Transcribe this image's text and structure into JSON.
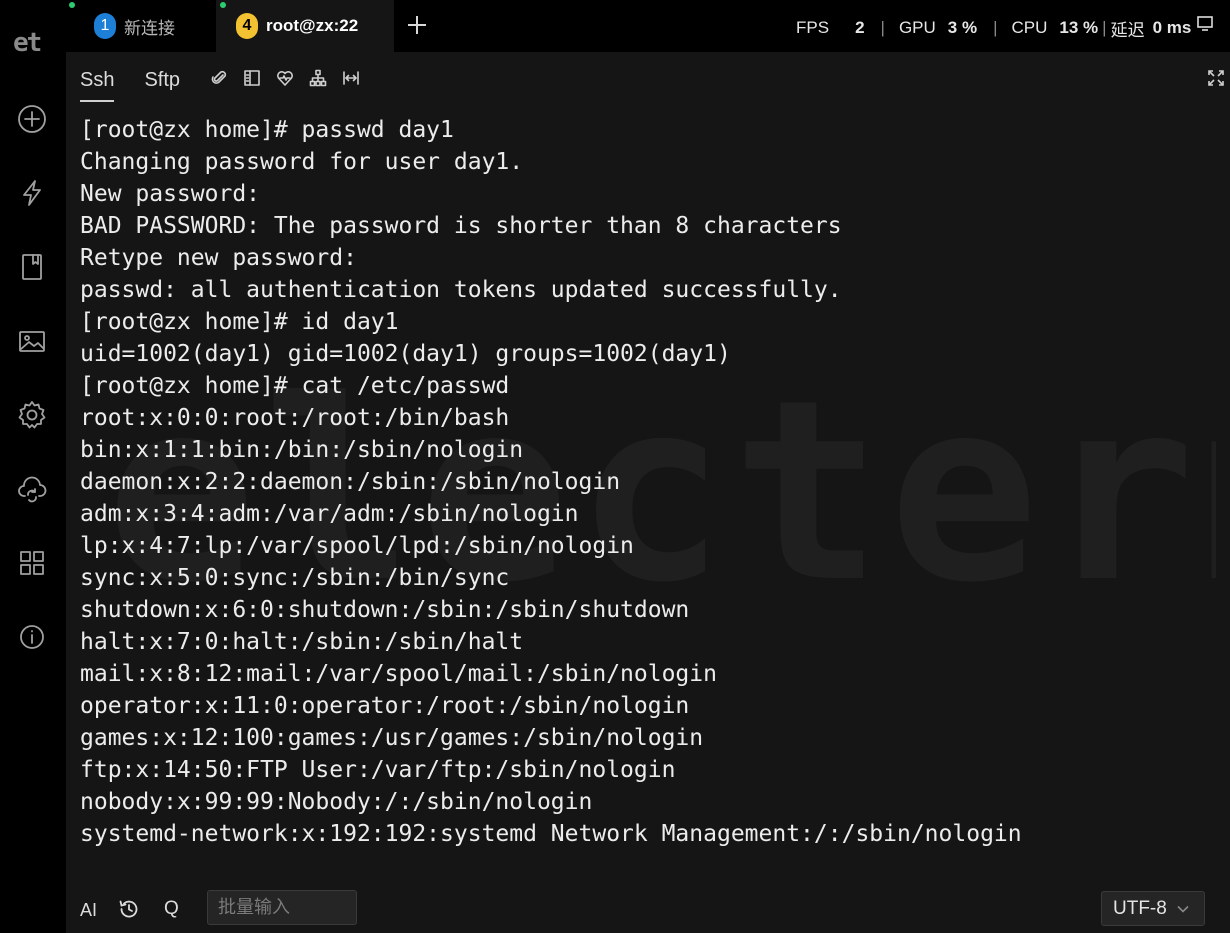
{
  "rail": {
    "logo": "et",
    "buttons": [
      {
        "name": "add-session",
        "icon": "plus-circle-icon"
      },
      {
        "name": "quick-commands",
        "icon": "lightning-icon"
      },
      {
        "name": "bookmarks",
        "icon": "book-icon"
      },
      {
        "name": "gallery",
        "icon": "image-icon"
      },
      {
        "name": "settings",
        "icon": "gear-icon"
      },
      {
        "name": "cloud-sync",
        "icon": "cloud-sync-icon"
      },
      {
        "name": "widgets",
        "icon": "grid-icon"
      },
      {
        "name": "about",
        "icon": "info-icon"
      }
    ]
  },
  "tabs": [
    {
      "number": "1",
      "label": "新连接",
      "active": false
    },
    {
      "number": "4",
      "label": "root@zx:22",
      "active": true
    }
  ],
  "stats": {
    "fps_label": "FPS",
    "fps_value": "2",
    "gpu_label": "GPU",
    "gpu_value": "3 %",
    "cpu_label": "CPU",
    "cpu_value": "13 %",
    "delay_label": "延迟",
    "delay_value": "0 ms"
  },
  "session": {
    "subtabs": [
      "Ssh",
      "Sftp"
    ],
    "active_subtab": "Ssh",
    "tool_icons": [
      "paperclip-icon",
      "split-pane-icon",
      "heartbeat-icon",
      "network-icon",
      "width-icon"
    ]
  },
  "watermark": "electerm",
  "terminal": {
    "lines": [
      "[root@zx home]# passwd day1",
      "Changing password for user day1.",
      "New password:",
      "BAD PASSWORD: The password is shorter than 8 characters",
      "Retype new password:",
      "passwd: all authentication tokens updated successfully.",
      "[root@zx home]# id day1",
      "uid=1002(day1) gid=1002(day1) groups=1002(day1)",
      "[root@zx home]# cat /etc/passwd",
      "root:x:0:0:root:/root:/bin/bash",
      "bin:x:1:1:bin:/bin:/sbin/nologin",
      "daemon:x:2:2:daemon:/sbin:/sbin/nologin",
      "adm:x:3:4:adm:/var/adm:/sbin/nologin",
      "lp:x:4:7:lp:/var/spool/lpd:/sbin/nologin",
      "sync:x:5:0:sync:/sbin:/bin/sync",
      "shutdown:x:6:0:shutdown:/sbin:/sbin/shutdown",
      "halt:x:7:0:halt:/sbin:/sbin/halt",
      "mail:x:8:12:mail:/var/spool/mail:/sbin/nologin",
      "operator:x:11:0:operator:/root:/sbin/nologin",
      "games:x:12:100:games:/usr/games:/sbin/nologin",
      "ftp:x:14:50:FTP User:/var/ftp:/sbin/nologin",
      "nobody:x:99:99:Nobody:/:/sbin/nologin",
      "systemd-network:x:192:192:systemd Network Management:/:/sbin/nologin"
    ]
  },
  "bottom": {
    "ai_label": "AI",
    "q_label": "Q",
    "batch_placeholder": "批量输入",
    "encoding": "UTF-8"
  }
}
